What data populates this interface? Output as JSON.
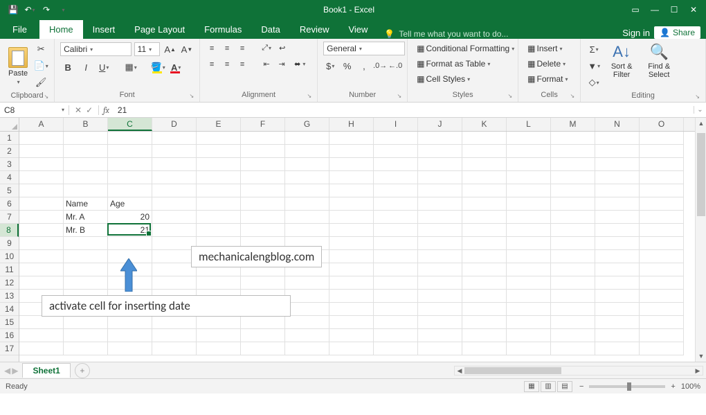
{
  "title": "Book1 - Excel",
  "tabs": {
    "file": "File",
    "home": "Home",
    "insert": "Insert",
    "pagelayout": "Page Layout",
    "formulas": "Formulas",
    "data": "Data",
    "review": "Review",
    "view": "View",
    "tell": "Tell me what you want to do...",
    "signin": "Sign in",
    "share": "Share"
  },
  "ribbon": {
    "clipboard": {
      "paste": "Paste",
      "label": "Clipboard"
    },
    "font": {
      "name": "Calibri",
      "size": "11",
      "label": "Font"
    },
    "alignment": {
      "wrap": "Wrap Text",
      "merge": "Merge & Center",
      "label": "Alignment"
    },
    "number": {
      "format": "General",
      "label": "Number"
    },
    "styles": {
      "cond": "Conditional Formatting",
      "table": "Format as Table",
      "cell": "Cell Styles",
      "label": "Styles"
    },
    "cells": {
      "insert": "Insert",
      "delete": "Delete",
      "format": "Format",
      "label": "Cells"
    },
    "editing": {
      "sort": "Sort & Filter",
      "find": "Find & Select",
      "label": "Editing"
    }
  },
  "namebox": "C8",
  "formula": "21",
  "columns": [
    "A",
    "B",
    "C",
    "D",
    "E",
    "F",
    "G",
    "H",
    "I",
    "J",
    "K",
    "L",
    "M",
    "N",
    "O"
  ],
  "rows": [
    1,
    2,
    3,
    4,
    5,
    6,
    7,
    8,
    9,
    10,
    11,
    12,
    13,
    14,
    15,
    16,
    17
  ],
  "selected": {
    "colIndex": 2,
    "rowIndex": 7
  },
  "data": {
    "6": {
      "B": "Name",
      "C": "Age"
    },
    "7": {
      "B": "Mr. A",
      "C": "20"
    },
    "8": {
      "B": "Mr. B",
      "C": "21"
    }
  },
  "numeric_cols": [
    "C"
  ],
  "sheet": "Sheet1",
  "overlays": {
    "watermark": "mechanicalengblog.com",
    "annotation": "activate cell for inserting date"
  },
  "status": {
    "ready": "Ready",
    "zoom": "100%"
  },
  "chart_data": {
    "type": "table",
    "columns": [
      "Name",
      "Age"
    ],
    "rows": [
      {
        "Name": "Mr. A",
        "Age": 20
      },
      {
        "Name": "Mr. B",
        "Age": 21
      }
    ]
  }
}
